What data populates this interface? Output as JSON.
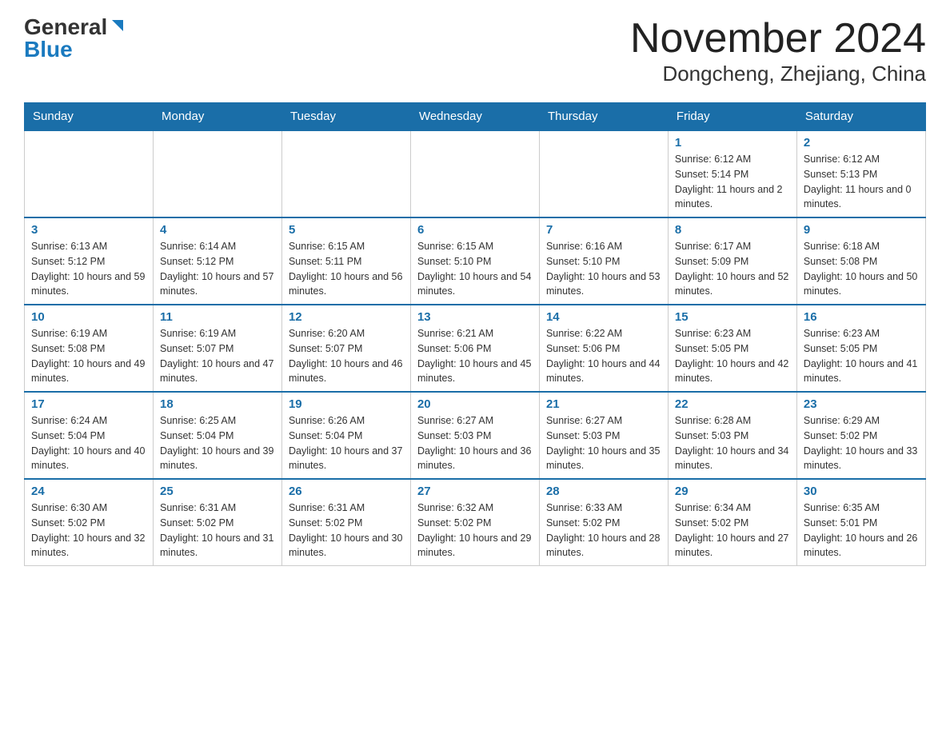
{
  "logo": {
    "general": "General",
    "blue": "Blue"
  },
  "title": "November 2024",
  "subtitle": "Dongcheng, Zhejiang, China",
  "days_of_week": [
    "Sunday",
    "Monday",
    "Tuesday",
    "Wednesday",
    "Thursday",
    "Friday",
    "Saturday"
  ],
  "weeks": [
    [
      {
        "day": "",
        "info": ""
      },
      {
        "day": "",
        "info": ""
      },
      {
        "day": "",
        "info": ""
      },
      {
        "day": "",
        "info": ""
      },
      {
        "day": "",
        "info": ""
      },
      {
        "day": "1",
        "info": "Sunrise: 6:12 AM\nSunset: 5:14 PM\nDaylight: 11 hours and 2 minutes."
      },
      {
        "day": "2",
        "info": "Sunrise: 6:12 AM\nSunset: 5:13 PM\nDaylight: 11 hours and 0 minutes."
      }
    ],
    [
      {
        "day": "3",
        "info": "Sunrise: 6:13 AM\nSunset: 5:12 PM\nDaylight: 10 hours and 59 minutes."
      },
      {
        "day": "4",
        "info": "Sunrise: 6:14 AM\nSunset: 5:12 PM\nDaylight: 10 hours and 57 minutes."
      },
      {
        "day": "5",
        "info": "Sunrise: 6:15 AM\nSunset: 5:11 PM\nDaylight: 10 hours and 56 minutes."
      },
      {
        "day": "6",
        "info": "Sunrise: 6:15 AM\nSunset: 5:10 PM\nDaylight: 10 hours and 54 minutes."
      },
      {
        "day": "7",
        "info": "Sunrise: 6:16 AM\nSunset: 5:10 PM\nDaylight: 10 hours and 53 minutes."
      },
      {
        "day": "8",
        "info": "Sunrise: 6:17 AM\nSunset: 5:09 PM\nDaylight: 10 hours and 52 minutes."
      },
      {
        "day": "9",
        "info": "Sunrise: 6:18 AM\nSunset: 5:08 PM\nDaylight: 10 hours and 50 minutes."
      }
    ],
    [
      {
        "day": "10",
        "info": "Sunrise: 6:19 AM\nSunset: 5:08 PM\nDaylight: 10 hours and 49 minutes."
      },
      {
        "day": "11",
        "info": "Sunrise: 6:19 AM\nSunset: 5:07 PM\nDaylight: 10 hours and 47 minutes."
      },
      {
        "day": "12",
        "info": "Sunrise: 6:20 AM\nSunset: 5:07 PM\nDaylight: 10 hours and 46 minutes."
      },
      {
        "day": "13",
        "info": "Sunrise: 6:21 AM\nSunset: 5:06 PM\nDaylight: 10 hours and 45 minutes."
      },
      {
        "day": "14",
        "info": "Sunrise: 6:22 AM\nSunset: 5:06 PM\nDaylight: 10 hours and 44 minutes."
      },
      {
        "day": "15",
        "info": "Sunrise: 6:23 AM\nSunset: 5:05 PM\nDaylight: 10 hours and 42 minutes."
      },
      {
        "day": "16",
        "info": "Sunrise: 6:23 AM\nSunset: 5:05 PM\nDaylight: 10 hours and 41 minutes."
      }
    ],
    [
      {
        "day": "17",
        "info": "Sunrise: 6:24 AM\nSunset: 5:04 PM\nDaylight: 10 hours and 40 minutes."
      },
      {
        "day": "18",
        "info": "Sunrise: 6:25 AM\nSunset: 5:04 PM\nDaylight: 10 hours and 39 minutes."
      },
      {
        "day": "19",
        "info": "Sunrise: 6:26 AM\nSunset: 5:04 PM\nDaylight: 10 hours and 37 minutes."
      },
      {
        "day": "20",
        "info": "Sunrise: 6:27 AM\nSunset: 5:03 PM\nDaylight: 10 hours and 36 minutes."
      },
      {
        "day": "21",
        "info": "Sunrise: 6:27 AM\nSunset: 5:03 PM\nDaylight: 10 hours and 35 minutes."
      },
      {
        "day": "22",
        "info": "Sunrise: 6:28 AM\nSunset: 5:03 PM\nDaylight: 10 hours and 34 minutes."
      },
      {
        "day": "23",
        "info": "Sunrise: 6:29 AM\nSunset: 5:02 PM\nDaylight: 10 hours and 33 minutes."
      }
    ],
    [
      {
        "day": "24",
        "info": "Sunrise: 6:30 AM\nSunset: 5:02 PM\nDaylight: 10 hours and 32 minutes."
      },
      {
        "day": "25",
        "info": "Sunrise: 6:31 AM\nSunset: 5:02 PM\nDaylight: 10 hours and 31 minutes."
      },
      {
        "day": "26",
        "info": "Sunrise: 6:31 AM\nSunset: 5:02 PM\nDaylight: 10 hours and 30 minutes."
      },
      {
        "day": "27",
        "info": "Sunrise: 6:32 AM\nSunset: 5:02 PM\nDaylight: 10 hours and 29 minutes."
      },
      {
        "day": "28",
        "info": "Sunrise: 6:33 AM\nSunset: 5:02 PM\nDaylight: 10 hours and 28 minutes."
      },
      {
        "day": "29",
        "info": "Sunrise: 6:34 AM\nSunset: 5:02 PM\nDaylight: 10 hours and 27 minutes."
      },
      {
        "day": "30",
        "info": "Sunrise: 6:35 AM\nSunset: 5:01 PM\nDaylight: 10 hours and 26 minutes."
      }
    ]
  ]
}
